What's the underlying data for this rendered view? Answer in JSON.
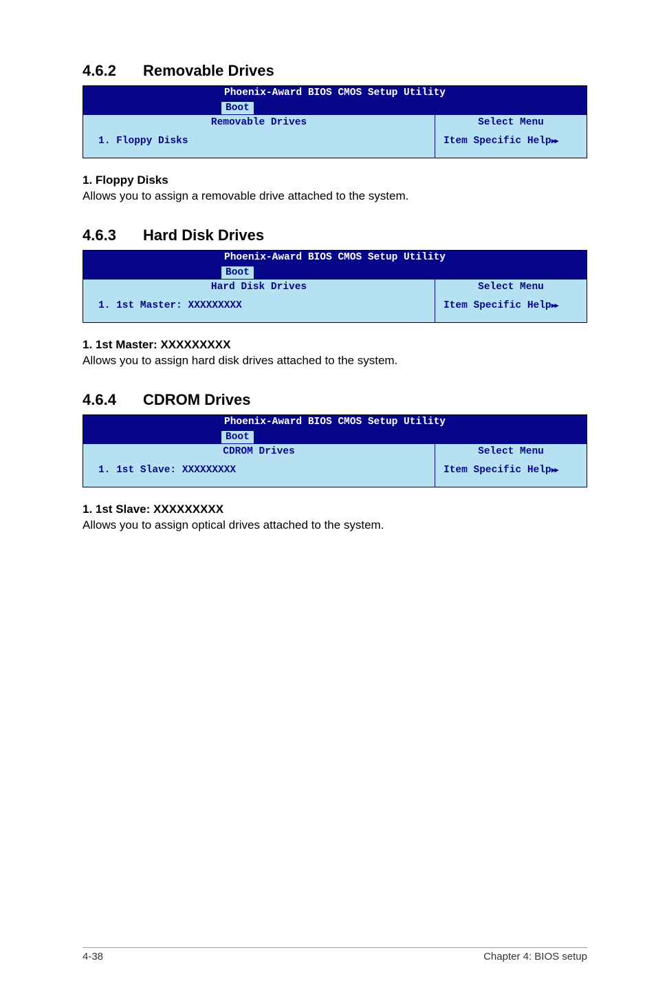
{
  "s462": {
    "num": "4.6.2",
    "title": "Removable Drives",
    "bios": {
      "utility": "Phoenix-Award BIOS CMOS Setup Utility",
      "tab": "Boot",
      "panel_title": "Removable Drives",
      "select_menu": "Select Menu",
      "item": "1. Floppy Disks",
      "help": "Item Specific Help"
    },
    "sub": "1. Floppy Disks",
    "desc": "Allows you to assign a removable drive attached to the system."
  },
  "s463": {
    "num": "4.6.3",
    "title": "Hard Disk Drives",
    "bios": {
      "utility": "Phoenix-Award BIOS CMOS Setup Utility",
      "tab": "Boot",
      "panel_title": "Hard Disk Drives",
      "select_menu": "Select Menu",
      "item": "1. 1st Master: XXXXXXXXX",
      "help": "Item Specific Help"
    },
    "sub": "1. 1st Master: XXXXXXXXX",
    "desc": "Allows you to assign hard disk drives attached to the system."
  },
  "s464": {
    "num": "4.6.4",
    "title": "CDROM Drives",
    "bios": {
      "utility": "Phoenix-Award BIOS CMOS Setup Utility",
      "tab": "Boot",
      "panel_title": "CDROM Drives",
      "select_menu": "Select Menu",
      "item": "1. 1st Slave: XXXXXXXXX",
      "help": "Item Specific Help"
    },
    "sub": "1. 1st Slave: XXXXXXXXX",
    "desc": "Allows you to assign optical drives attached to the system."
  },
  "footer": {
    "page": "4-38",
    "chapter": "Chapter 4: BIOS setup"
  }
}
